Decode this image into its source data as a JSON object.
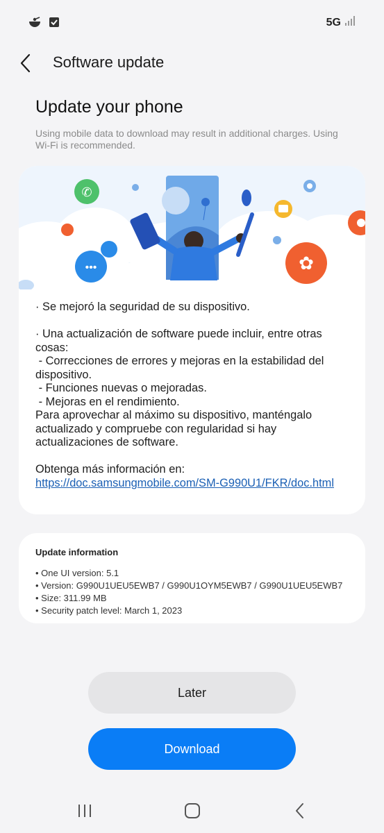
{
  "status_bar": {
    "left_icons": [
      "notification-app-icon",
      "checkbox-icon"
    ],
    "network_label": "5G",
    "right_icons": [
      "signal-icon"
    ]
  },
  "app_bar": {
    "back_icon": "back-arrow-icon",
    "title": "Software update"
  },
  "main": {
    "heading": "Update your phone",
    "notice": "Using mobile data to download may result in additional charges. Using Wi-Fi is recommended.",
    "release_notes": "· Se mejoró la seguridad de su dispositivo.\n\n· Una actualización de software puede incluir, entre otras cosas:\n - Correcciones de errores y mejoras en la estabilidad del dispositivo.\n - Funciones nuevas o mejoradas.\n - Mejoras en el rendimiento.\nPara aprovechar al máximo su dispositivo, manténgalo actualizado y compruebe con regularidad si hay actualizaciones de software.\n\nObtenga más información en:",
    "more_info_link": "https://doc.samsungmobile.com/SM-G990U1/FKR/doc.html"
  },
  "update_info": {
    "title": "Update information",
    "items": [
      "• One UI version: 5.1",
      "• Version: G990U1UEU5EWB7 / G990U1OYM5EWB7 / G990U1UEU5EWB7",
      "• Size: 311.99 MB",
      "• Security patch level: March 1, 2023"
    ]
  },
  "buttons": {
    "later_label": "Later",
    "download_label": "Download"
  },
  "nav_bar": {
    "icons": [
      "recent-apps-icon",
      "home-icon",
      "back-icon"
    ]
  },
  "colors": {
    "accent": "#0a7df6",
    "background": "#f4f4f6",
    "card": "#ffffff",
    "link": "#1a5fb4"
  }
}
